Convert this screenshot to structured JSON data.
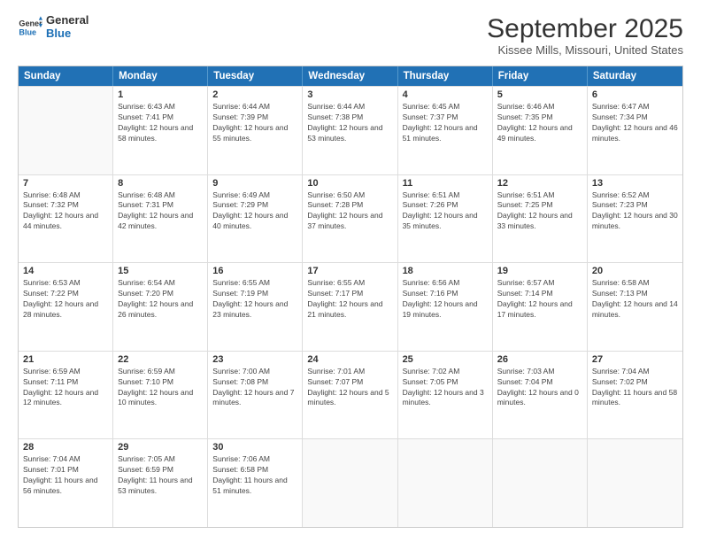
{
  "logo": {
    "line1": "General",
    "line2": "Blue"
  },
  "title": "September 2025",
  "location": "Kissee Mills, Missouri, United States",
  "header_days": [
    "Sunday",
    "Monday",
    "Tuesday",
    "Wednesday",
    "Thursday",
    "Friday",
    "Saturday"
  ],
  "rows": [
    [
      {
        "day": "",
        "empty": true
      },
      {
        "day": "1",
        "sunrise": "6:43 AM",
        "sunset": "7:41 PM",
        "daylight": "12 hours and 58 minutes."
      },
      {
        "day": "2",
        "sunrise": "6:44 AM",
        "sunset": "7:39 PM",
        "daylight": "12 hours and 55 minutes."
      },
      {
        "day": "3",
        "sunrise": "6:44 AM",
        "sunset": "7:38 PM",
        "daylight": "12 hours and 53 minutes."
      },
      {
        "day": "4",
        "sunrise": "6:45 AM",
        "sunset": "7:37 PM",
        "daylight": "12 hours and 51 minutes."
      },
      {
        "day": "5",
        "sunrise": "6:46 AM",
        "sunset": "7:35 PM",
        "daylight": "12 hours and 49 minutes."
      },
      {
        "day": "6",
        "sunrise": "6:47 AM",
        "sunset": "7:34 PM",
        "daylight": "12 hours and 46 minutes."
      }
    ],
    [
      {
        "day": "7",
        "sunrise": "6:48 AM",
        "sunset": "7:32 PM",
        "daylight": "12 hours and 44 minutes."
      },
      {
        "day": "8",
        "sunrise": "6:48 AM",
        "sunset": "7:31 PM",
        "daylight": "12 hours and 42 minutes."
      },
      {
        "day": "9",
        "sunrise": "6:49 AM",
        "sunset": "7:29 PM",
        "daylight": "12 hours and 40 minutes."
      },
      {
        "day": "10",
        "sunrise": "6:50 AM",
        "sunset": "7:28 PM",
        "daylight": "12 hours and 37 minutes."
      },
      {
        "day": "11",
        "sunrise": "6:51 AM",
        "sunset": "7:26 PM",
        "daylight": "12 hours and 35 minutes."
      },
      {
        "day": "12",
        "sunrise": "6:51 AM",
        "sunset": "7:25 PM",
        "daylight": "12 hours and 33 minutes."
      },
      {
        "day": "13",
        "sunrise": "6:52 AM",
        "sunset": "7:23 PM",
        "daylight": "12 hours and 30 minutes."
      }
    ],
    [
      {
        "day": "14",
        "sunrise": "6:53 AM",
        "sunset": "7:22 PM",
        "daylight": "12 hours and 28 minutes."
      },
      {
        "day": "15",
        "sunrise": "6:54 AM",
        "sunset": "7:20 PM",
        "daylight": "12 hours and 26 minutes."
      },
      {
        "day": "16",
        "sunrise": "6:55 AM",
        "sunset": "7:19 PM",
        "daylight": "12 hours and 23 minutes."
      },
      {
        "day": "17",
        "sunrise": "6:55 AM",
        "sunset": "7:17 PM",
        "daylight": "12 hours and 21 minutes."
      },
      {
        "day": "18",
        "sunrise": "6:56 AM",
        "sunset": "7:16 PM",
        "daylight": "12 hours and 19 minutes."
      },
      {
        "day": "19",
        "sunrise": "6:57 AM",
        "sunset": "7:14 PM",
        "daylight": "12 hours and 17 minutes."
      },
      {
        "day": "20",
        "sunrise": "6:58 AM",
        "sunset": "7:13 PM",
        "daylight": "12 hours and 14 minutes."
      }
    ],
    [
      {
        "day": "21",
        "sunrise": "6:59 AM",
        "sunset": "7:11 PM",
        "daylight": "12 hours and 12 minutes."
      },
      {
        "day": "22",
        "sunrise": "6:59 AM",
        "sunset": "7:10 PM",
        "daylight": "12 hours and 10 minutes."
      },
      {
        "day": "23",
        "sunrise": "7:00 AM",
        "sunset": "7:08 PM",
        "daylight": "12 hours and 7 minutes."
      },
      {
        "day": "24",
        "sunrise": "7:01 AM",
        "sunset": "7:07 PM",
        "daylight": "12 hours and 5 minutes."
      },
      {
        "day": "25",
        "sunrise": "7:02 AM",
        "sunset": "7:05 PM",
        "daylight": "12 hours and 3 minutes."
      },
      {
        "day": "26",
        "sunrise": "7:03 AM",
        "sunset": "7:04 PM",
        "daylight": "12 hours and 0 minutes."
      },
      {
        "day": "27",
        "sunrise": "7:04 AM",
        "sunset": "7:02 PM",
        "daylight": "11 hours and 58 minutes."
      }
    ],
    [
      {
        "day": "28",
        "sunrise": "7:04 AM",
        "sunset": "7:01 PM",
        "daylight": "11 hours and 56 minutes."
      },
      {
        "day": "29",
        "sunrise": "7:05 AM",
        "sunset": "6:59 PM",
        "daylight": "11 hours and 53 minutes."
      },
      {
        "day": "30",
        "sunrise": "7:06 AM",
        "sunset": "6:58 PM",
        "daylight": "11 hours and 51 minutes."
      },
      {
        "day": "",
        "empty": true
      },
      {
        "day": "",
        "empty": true
      },
      {
        "day": "",
        "empty": true
      },
      {
        "day": "",
        "empty": true
      }
    ]
  ]
}
